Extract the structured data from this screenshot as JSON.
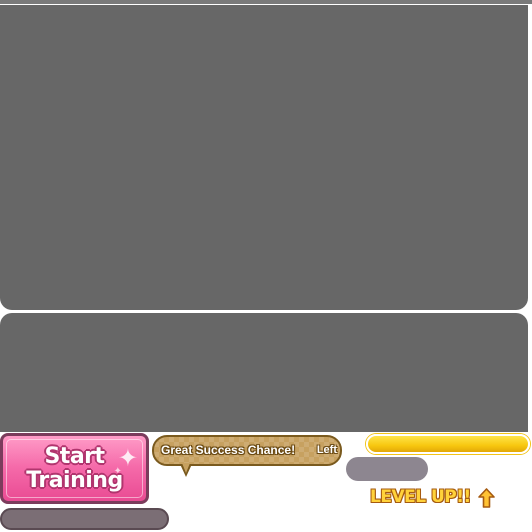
{
  "training_button": {
    "label": "Start\nTraining"
  },
  "success_bubble": {
    "text": "Great Success Chance!",
    "suffix": "Left"
  },
  "level_up": {
    "text": "LEVEL UP!!"
  },
  "colors": {
    "button_pink": "#f56aa9",
    "bubble_gold": "#c7a160",
    "bar_yellow": "#f7c70f",
    "level_up_text": "#ffd23a"
  },
  "icons": {
    "level_up_arrow": "arrow-up-icon",
    "sparkle": "sparkle-icon"
  }
}
